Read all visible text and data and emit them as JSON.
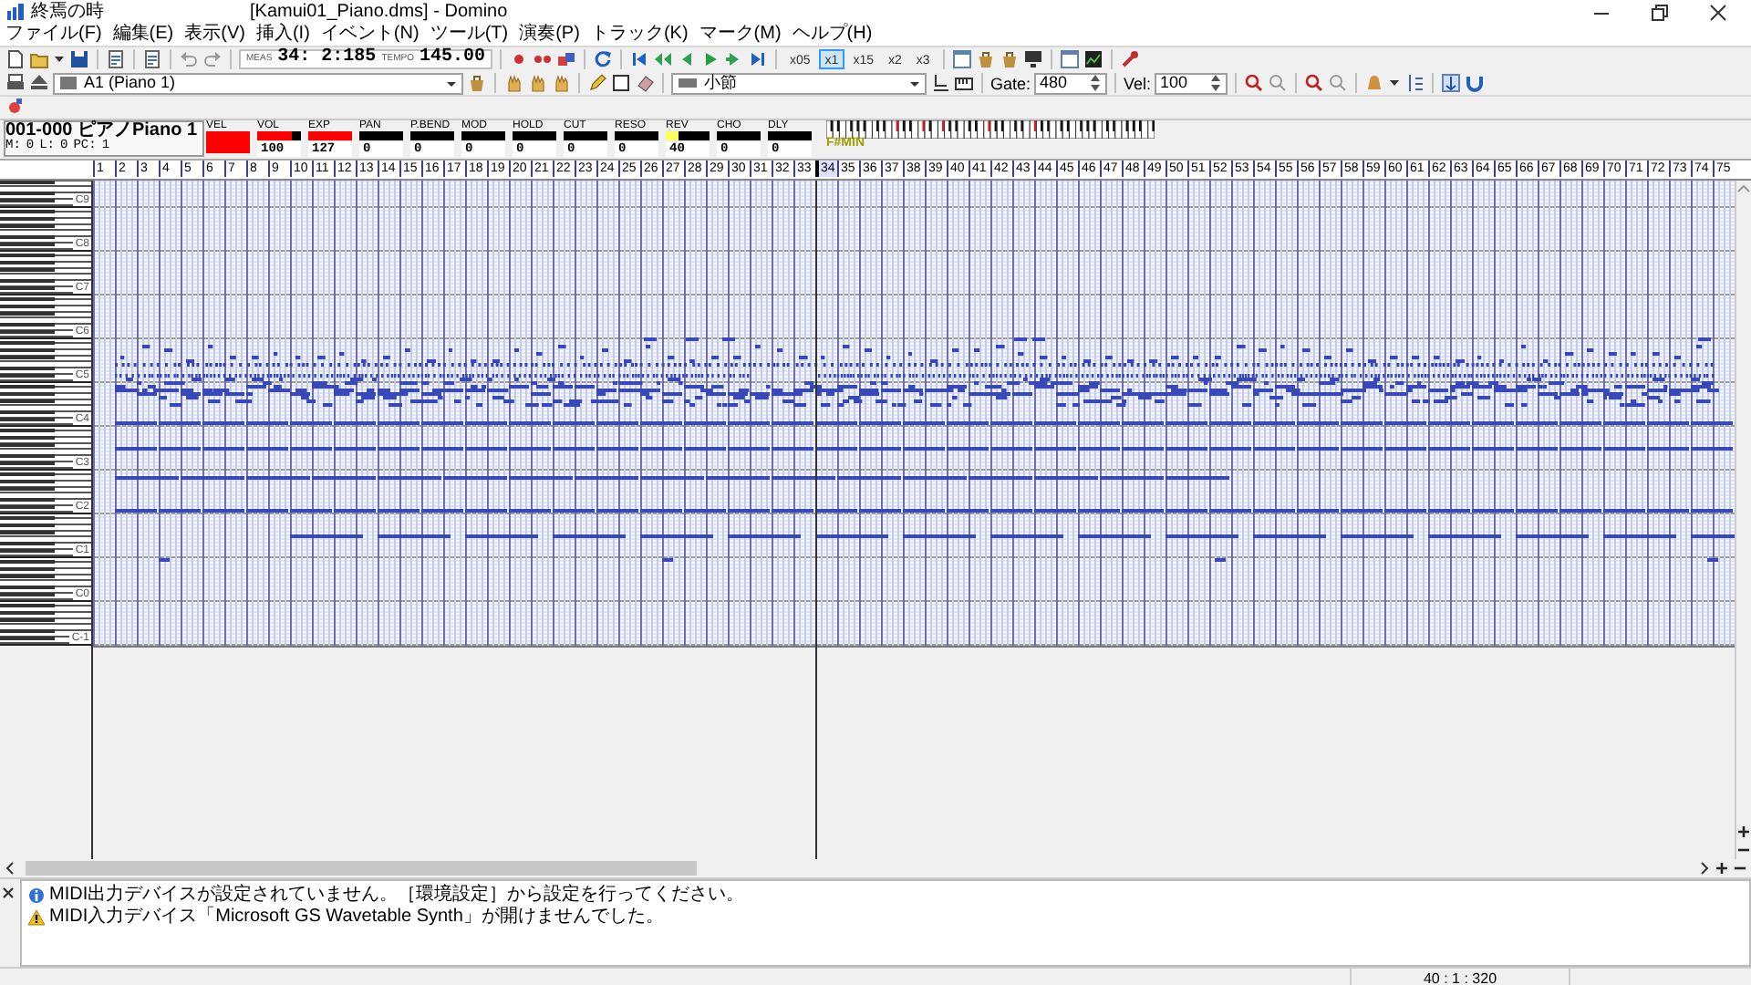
{
  "window": {
    "title": "終焉の時",
    "document_title": "[Kamui01_Piano.dms] - Domino"
  },
  "menu": [
    "ファイル(F)",
    "編集(E)",
    "表示(V)",
    "挿入(I)",
    "イベント(N)",
    "ツール(T)",
    "演奏(P)",
    "トラック(K)",
    "マーク(M)",
    "ヘルプ(H)"
  ],
  "toolbar": {
    "measure_label": "MEAS",
    "position": "34: 2:185",
    "tempo_label": "TEMPO",
    "tempo": "145.00",
    "speeds": [
      {
        "label": "x05",
        "selected": false
      },
      {
        "label": "x1",
        "selected": true
      },
      {
        "label": "x15",
        "selected": false
      },
      {
        "label": "x2",
        "selected": false
      },
      {
        "label": "x3",
        "selected": false
      }
    ]
  },
  "track_toolbar": {
    "track": "A1 (Piano 1)",
    "snap": "小節",
    "gate_label": "Gate:",
    "gate": "480",
    "vel_label": "Vel:",
    "vel": "100"
  },
  "track_info": {
    "name": "001-000 ピアノPiano 1",
    "fields": [
      {
        "label": "M:",
        "value": "0"
      },
      {
        "label": "L:",
        "value": "0"
      },
      {
        "label": "PC:",
        "value": "1"
      }
    ],
    "controllers": [
      {
        "label": "VEL",
        "level": 1,
        "color": "#ff0000"
      },
      {
        "label": "VOL",
        "value": "100",
        "level": 0.79,
        "color": "#ff0000"
      },
      {
        "label": "EXP",
        "value": "127",
        "level": 1,
        "color": "#ff0000"
      },
      {
        "label": "PAN",
        "value": "0",
        "level": 0
      },
      {
        "label": "P.BEND",
        "value": "0",
        "level": 0
      },
      {
        "label": "MOD",
        "value": "0",
        "level": 0
      },
      {
        "label": "HOLD",
        "value": "0",
        "level": 0
      },
      {
        "label": "CUT",
        "value": "0",
        "level": 0
      },
      {
        "label": "RESO",
        "value": "0",
        "level": 0
      },
      {
        "label": "REV",
        "value": "40",
        "level": 0.31,
        "color": "#ffff60"
      },
      {
        "label": "CHO",
        "value": "0",
        "level": 0
      },
      {
        "label": "DLY",
        "value": "0",
        "level": 0
      }
    ],
    "chord": "F#MIN"
  },
  "ruler": {
    "measures": [
      {
        "label": "1",
        "playhead": false
      },
      {
        "label": "2",
        "playhead": false
      },
      {
        "label": "3",
        "playhead": false
      },
      {
        "label": "4",
        "playhead": false
      },
      {
        "label": "5",
        "playhead": false
      },
      {
        "label": "6",
        "playhead": false
      },
      {
        "label": "7",
        "playhead": false
      },
      {
        "label": "8",
        "playhead": false
      },
      {
        "label": "9",
        "playhead": false
      },
      {
        "label": "10",
        "playhead": false
      },
      {
        "label": "11",
        "playhead": false
      },
      {
        "label": "12",
        "playhead": false
      },
      {
        "label": "13",
        "playhead": false
      },
      {
        "label": "14",
        "playhead": false
      },
      {
        "label": "15",
        "playhead": false
      },
      {
        "label": "16",
        "playhead": false
      },
      {
        "label": "17",
        "playhead": false
      },
      {
        "label": "18",
        "playhead": false
      },
      {
        "label": "19",
        "playhead": false
      },
      {
        "label": "20",
        "playhead": false
      },
      {
        "label": "21",
        "playhead": false
      },
      {
        "label": "22",
        "playhead": false
      },
      {
        "label": "23",
        "playhead": false
      },
      {
        "label": "24",
        "playhead": false
      },
      {
        "label": "25",
        "playhead": false
      },
      {
        "label": "26",
        "playhead": false
      },
      {
        "label": "27",
        "playhead": false
      },
      {
        "label": "28",
        "playhead": false
      },
      {
        "label": "29",
        "playhead": false
      },
      {
        "label": "30",
        "playhead": false
      },
      {
        "label": "31",
        "playhead": false
      },
      {
        "label": "32",
        "playhead": false
      },
      {
        "label": "33",
        "playhead": false
      },
      {
        "label": "34",
        "playhead": true
      },
      {
        "label": "35",
        "playhead": false
      },
      {
        "label": "36",
        "playhead": false
      },
      {
        "label": "37",
        "playhead": false
      },
      {
        "label": "38",
        "playhead": false
      },
      {
        "label": "39",
        "playhead": false
      },
      {
        "label": "40",
        "playhead": false
      },
      {
        "label": "41",
        "playhead": false
      },
      {
        "label": "42",
        "playhead": false
      },
      {
        "label": "43",
        "playhead": false
      },
      {
        "label": "44",
        "playhead": false
      },
      {
        "label": "45",
        "playhead": false
      },
      {
        "label": "46",
        "playhead": false
      },
      {
        "label": "47",
        "playhead": false
      },
      {
        "label": "48",
        "playhead": false
      },
      {
        "label": "49",
        "playhead": false
      },
      {
        "label": "50",
        "playhead": false
      },
      {
        "label": "51",
        "playhead": false
      },
      {
        "label": "52",
        "playhead": false
      },
      {
        "label": "53",
        "playhead": false
      },
      {
        "label": "54",
        "playhead": false
      },
      {
        "label": "55",
        "playhead": false
      },
      {
        "label": "56",
        "playhead": false
      },
      {
        "label": "57",
        "playhead": false
      },
      {
        "label": "58",
        "playhead": false
      },
      {
        "label": "59",
        "playhead": false
      },
      {
        "label": "60",
        "playhead": false
      },
      {
        "label": "61",
        "playhead": false
      },
      {
        "label": "62",
        "playhead": false
      },
      {
        "label": "63",
        "playhead": false
      },
      {
        "label": "64",
        "playhead": false
      },
      {
        "label": "65",
        "playhead": false
      },
      {
        "label": "66",
        "playhead": false
      },
      {
        "label": "67",
        "playhead": false
      },
      {
        "label": "68",
        "playhead": false
      },
      {
        "label": "69",
        "playhead": false
      },
      {
        "label": "70",
        "playhead": false
      },
      {
        "label": "71",
        "playhead": false
      },
      {
        "label": "72",
        "playhead": false
      },
      {
        "label": "73",
        "playhead": false
      },
      {
        "label": "74",
        "playhead": false
      },
      {
        "label": "75",
        "playhead": false
      }
    ]
  },
  "keyboard": {
    "octave_labels": [
      "C9",
      "C8",
      "C7",
      "C6",
      "C5",
      "C4",
      "C3",
      "C2",
      "C1",
      "C0",
      "C-1"
    ]
  },
  "messages": [
    {
      "kind": "info",
      "text": "MIDI出力デバイスが設定されていません。［環境設定］から設定を行ってください。"
    },
    {
      "kind": "warning",
      "text": "MIDI入力デバイス「Microsoft GS Wavetable Synth」が開けませんでした。"
    }
  ],
  "status_bar": {
    "position": "40 : 1 : 320"
  }
}
